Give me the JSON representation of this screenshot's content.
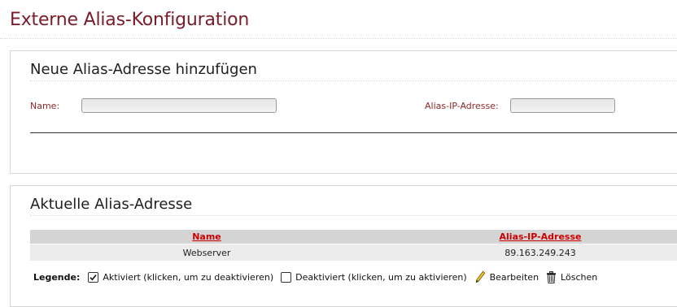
{
  "page": {
    "title": "Externe Alias-Konfiguration"
  },
  "add_panel": {
    "heading": "Neue Alias-Adresse hinzufügen",
    "name_label": "Name:",
    "name_value": "",
    "ip_label": "Alias-IP-Adresse:",
    "ip_value": ""
  },
  "list_panel": {
    "heading": "Aktuelle Alias-Adresse",
    "columns": {
      "name": "Name",
      "ip": "Alias-IP-Adresse"
    },
    "rows": [
      {
        "name": "Webserver",
        "ip": "89.163.249.243"
      }
    ]
  },
  "legend": {
    "title": "Legende:",
    "items": [
      {
        "icon": "checkbox-checked-icon",
        "label": "Aktiviert (klicken, um zu deaktivieren)"
      },
      {
        "icon": "checkbox-empty-icon",
        "label": "Deaktiviert (klicken, um zu aktivieren)"
      },
      {
        "icon": "pencil-icon",
        "label": "Bearbeiten"
      },
      {
        "icon": "trash-icon",
        "label": "Löschen"
      }
    ]
  },
  "colors": {
    "title": "#7a1c2a",
    "label": "#8b2a2a",
    "column_link": "#cc0000",
    "header_bg": "#d4d4d4",
    "row_bg": "#ececec"
  }
}
